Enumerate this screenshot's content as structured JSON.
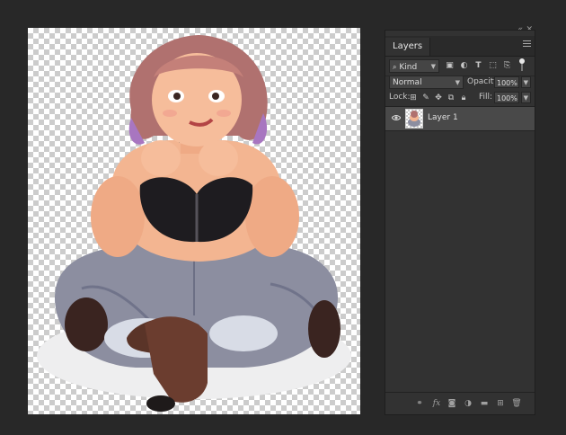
{
  "panel": {
    "tab_label": "Layers",
    "filter": {
      "kind_label": "Kind"
    },
    "blend_mode": "Normal",
    "opacity_label": "Opacity:",
    "opacity_value": "100%",
    "lock_label": "Lock:",
    "fill_label": "Fill:",
    "fill_value": "100%",
    "layers": [
      {
        "name": "Layer 1",
        "visible": true
      }
    ]
  },
  "icons": {
    "collapse": "double-chevron-icon",
    "close": "close-icon",
    "menu": "panel-menu-icon",
    "filter_search": "search-icon",
    "filter_image": "image-filter-icon",
    "filter_adjust": "adjustment-filter-icon",
    "filter_type": "type-filter-icon",
    "filter_shape": "shape-filter-icon",
    "filter_smart": "smart-object-filter-icon",
    "filter_toggle": "filter-toggle-icon",
    "lock_pixels": "lock-transparent-icon",
    "lock_paint": "lock-paint-icon",
    "lock_move": "lock-position-icon",
    "lock_artboard": "lock-artboard-icon",
    "lock_all": "lock-all-icon",
    "link": "link-layers-icon",
    "fx": "fx-icon",
    "mask": "add-mask-icon",
    "adjust": "new-adjustment-icon",
    "group": "new-group-icon",
    "new_layer": "new-layer-icon",
    "delete": "trash-icon"
  },
  "colors": {
    "app_bg": "#282828",
    "panel_bg": "#323232",
    "selected_layer": "#494949"
  }
}
